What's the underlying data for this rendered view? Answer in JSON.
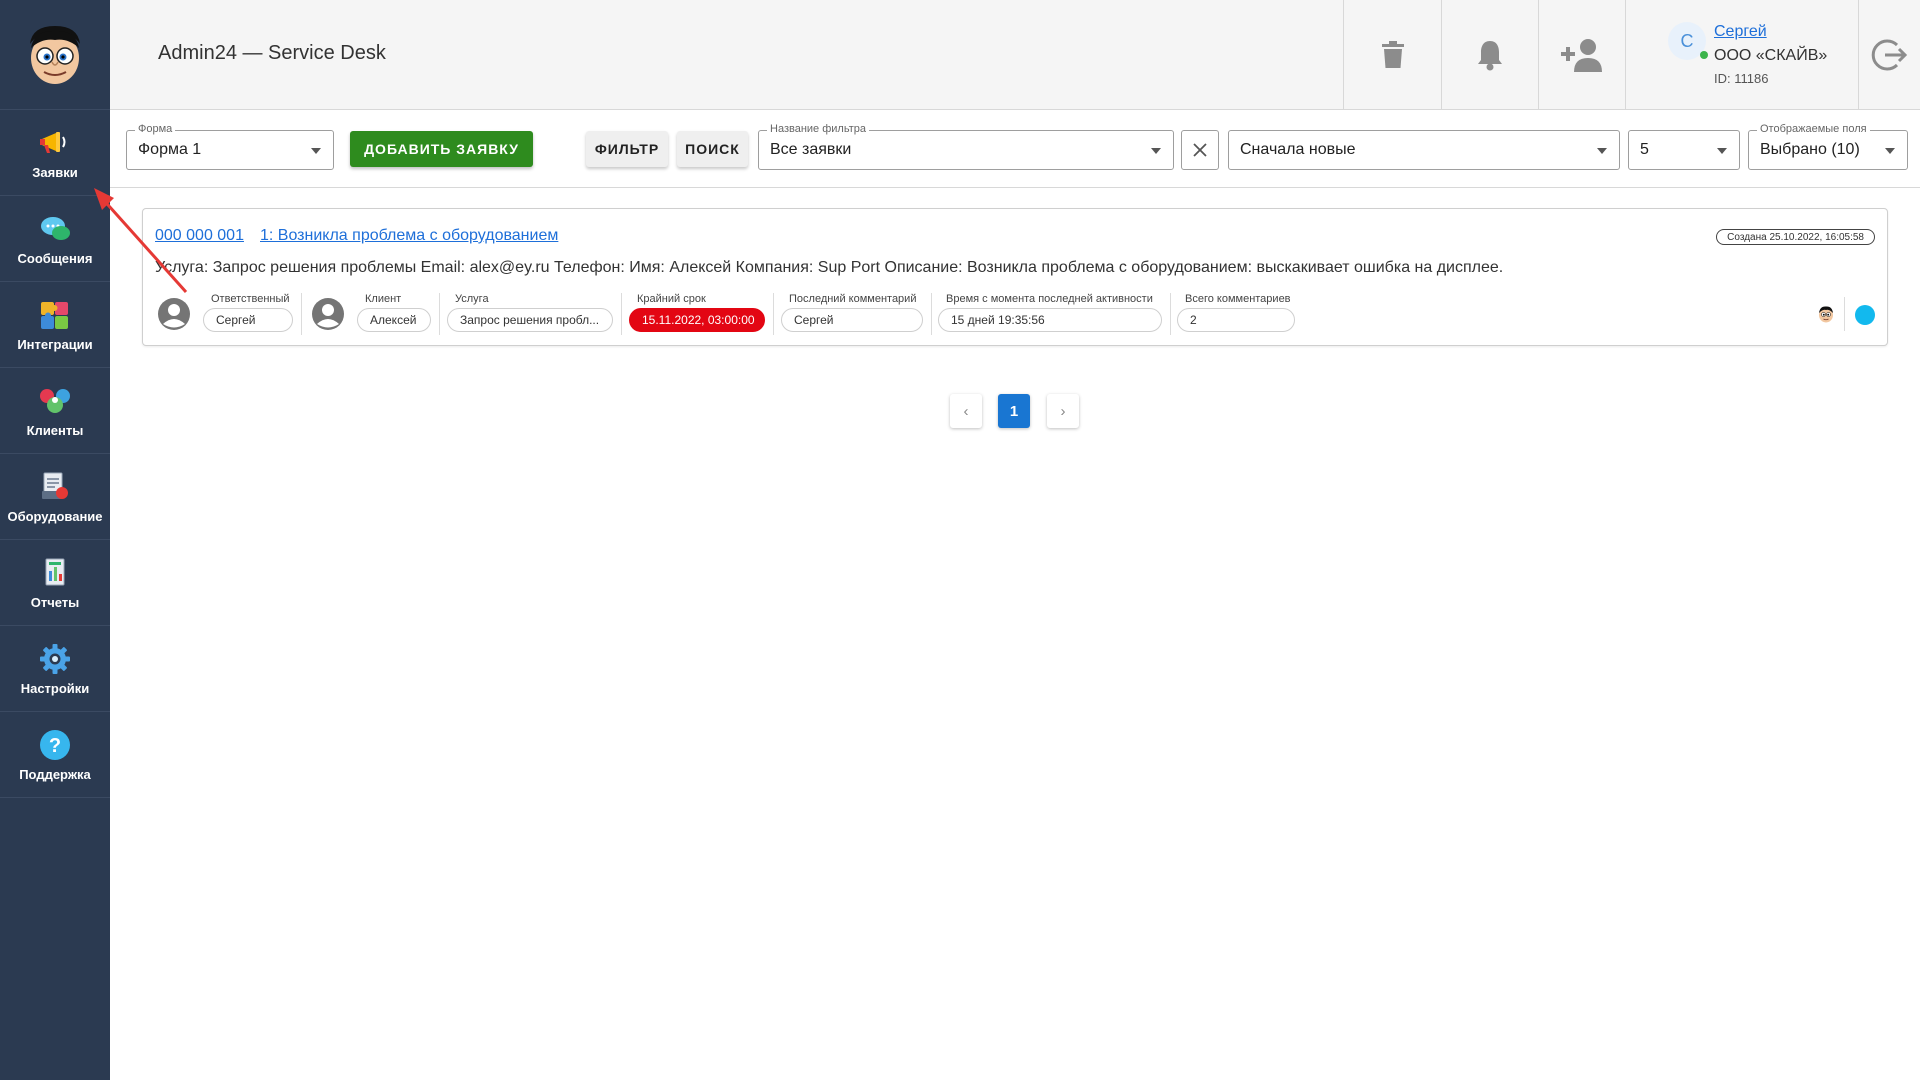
{
  "app": {
    "title": "Admin24 — Service Desk"
  },
  "sidebar": {
    "items": [
      {
        "label": "Заявки",
        "icon": "megaphone-icon"
      },
      {
        "label": "Сообщения",
        "icon": "chat-bubbles-icon"
      },
      {
        "label": "Интеграции",
        "icon": "puzzle-icon"
      },
      {
        "label": "Клиенты",
        "icon": "people-icon"
      },
      {
        "label": "Оборудование",
        "icon": "equipment-icon"
      },
      {
        "label": "Отчеты",
        "icon": "report-icon"
      },
      {
        "label": "Настройки",
        "icon": "gear-icon"
      },
      {
        "label": "Поддержка",
        "icon": "help-icon"
      }
    ]
  },
  "user": {
    "initial": "С",
    "name": "Сергей",
    "company": "ООО «СКАЙВ»",
    "id": "ID: 11186"
  },
  "toolbar": {
    "form": {
      "label": "Форма",
      "value": "Форма 1"
    },
    "add_label": "ДОБАВИТЬ ЗАЯВКУ",
    "filter_label": "ФИЛЬТР",
    "search_label": "ПОИСК",
    "filter_name": {
      "label": "Название фильтра",
      "value": "Все заявки"
    },
    "sort": {
      "value": "Сначала новые"
    },
    "per_page": {
      "value": "5"
    },
    "fields": {
      "label": "Отображаемые поля",
      "value": "Выбрано (10)"
    }
  },
  "ticket": {
    "number": "000 000 001",
    "title": "1: Возникла проблема с оборудованием",
    "created": "Создана 25.10.2022, 16:05:58",
    "description": "Услуга: Запрос решения проблемы Email: alex@ey.ru Телефон: Имя: Алексей Компания: Sup Port Описание: Возникла проблема с оборудованием: выскакивает ошибка на дисплее.",
    "responsible": {
      "label": "Ответственный",
      "value": "Сергей"
    },
    "client": {
      "label": "Клиент",
      "value": "Алексей"
    },
    "service": {
      "label": "Услуга",
      "value": "Запрос решения пробл..."
    },
    "deadline": {
      "label": "Крайний срок",
      "value": "15.11.2022, 03:00:00"
    },
    "last_comment": {
      "label": "Последний комментарий",
      "value": "Сергей"
    },
    "since_activity": {
      "label": "Время с момента последней активности",
      "value": "15 дней 19:35:56"
    },
    "total_comments": {
      "label": "Всего комментариев",
      "value": "2"
    }
  },
  "pagination": {
    "prev": "‹",
    "current": "1",
    "next": "›"
  },
  "colors": {
    "sidebar": "#2b3a51",
    "accent": "#1976d2",
    "add_button": "#2e8b1e",
    "deadline": "#e30613",
    "status_dot": "#12b9ee"
  }
}
